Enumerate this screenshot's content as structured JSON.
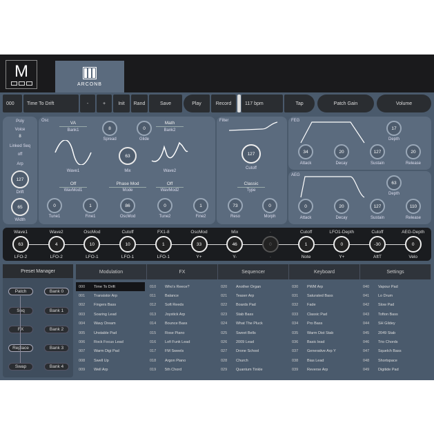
{
  "brand": {
    "logo": "M",
    "tab": "ARCONB"
  },
  "transport": {
    "patch_no": "000",
    "patch_name": "Time To Drift",
    "minus": "-",
    "plus": "+",
    "init": "Init",
    "rand": "Rand",
    "save": "Save",
    "play": "Play",
    "record": "Record",
    "bpm": "117 bpm",
    "tap": "Tap",
    "patch_gain": "Patch Gain",
    "volume": "Volume"
  },
  "voice": {
    "poly": "Poly",
    "voice": "Voice",
    "voice_val": "8",
    "linked": "Linked Seq",
    "off": "off",
    "arp": "Arp",
    "drift": "127",
    "drift_lbl": "Drift",
    "width": "65",
    "width_lbl": "Width"
  },
  "osc": {
    "title": "Osc",
    "wave1_type": "VA",
    "wave1_bank": "Bank1",
    "spread": "8",
    "spread_lbl": "Spread",
    "glide": "0",
    "glide_lbl": "Glide",
    "wave2_type": "Math",
    "wave2_bank": "Bank2",
    "wave1_lbl": "Wave1",
    "mix": "63",
    "mix_lbl": "Mix",
    "wave2_lbl": "Wave2",
    "wm1": "Off",
    "wm1_lbl": "WavMod1",
    "mode": "Phase Mod",
    "mode_lbl": "Mode",
    "wm2": "Off",
    "wm2_lbl": "WavMod2",
    "tune1": "0",
    "tune1_lbl": "Tune1",
    "fine1": "1",
    "fine1_lbl": "Fine1",
    "oscmod": "86",
    "oscmod_lbl": "OscMod",
    "tune2": "0",
    "tune2_lbl": "Tune2",
    "fine2": "1",
    "fine2_lbl": "Fine2"
  },
  "filter": {
    "title": "Filter",
    "cutoff": "127",
    "cutoff_lbl": "Cutoff",
    "type": "Classic",
    "type_lbl": "Type",
    "reso": "73",
    "reso_lbl": "Reso",
    "morph": "0",
    "morph_lbl": "Morph"
  },
  "feg": {
    "title": "FEG",
    "depth": "17",
    "depth_lbl": "Depth",
    "attack": "34",
    "decay": "20",
    "sustain": "127",
    "release": "20"
  },
  "aeg": {
    "title": "AEG",
    "depth": "63",
    "depth_lbl": "Depth",
    "attack": "0",
    "decay": "20",
    "sustain": "127",
    "release": "110"
  },
  "env_lbls": {
    "attack": "Attack",
    "decay": "Decay",
    "sustain": "Sustain",
    "release": "Release"
  },
  "mods": [
    {
      "t": "Wave1",
      "v": "63",
      "b": "LFO-2"
    },
    {
      "t": "Wave2",
      "v": "4",
      "b": "LFO-2"
    },
    {
      "t": "OscMod",
      "v": "10",
      "b": "LFO-1"
    },
    {
      "t": "Cutoff",
      "v": "10",
      "b": "LFO-1"
    },
    {
      "t": "FX1-8",
      "v": "1",
      "b": "LFO-1"
    },
    {
      "t": "OscMod",
      "v": "33",
      "b": "Y+"
    },
    {
      "t": "Mix",
      "v": "46",
      "b": "Y-"
    },
    {
      "t": "-",
      "v": "0",
      "b": "-"
    },
    {
      "t": "Cutoff",
      "v": "1",
      "b": "Note"
    },
    {
      "t": "LFO1-Depth",
      "v": "0",
      "b": "Y+"
    },
    {
      "t": "Cutoff",
      "v": "-30",
      "b": "AftT"
    },
    {
      "t": "AEG-Depth",
      "v": "0",
      "b": "Velo"
    }
  ],
  "preset_manager": {
    "title": "Preset Manager",
    "patch": "Patch",
    "seq": "Seq",
    "fx": "FX",
    "replace": "Replace",
    "swap": "Swap",
    "bank0": "Bank 0",
    "bank1": "Bank 1",
    "bank2": "Bank 2",
    "bank3": "Bank 3",
    "bank4": "Bank 4"
  },
  "columns": [
    {
      "head": "Modulation",
      "rows": [
        [
          "000",
          "Time To Drift"
        ],
        [
          "001",
          "Transistor Arp"
        ],
        [
          "002",
          "Fingers Bass"
        ],
        [
          "003",
          "Soaring Lead"
        ],
        [
          "004",
          "Wavy Dream"
        ],
        [
          "005",
          "Unstable Pad"
        ],
        [
          "006",
          "Rock Focus Lead"
        ],
        [
          "007",
          "Warm Digi Pad"
        ],
        [
          "008",
          "Swell Up"
        ],
        [
          "009",
          "Well Arp"
        ]
      ]
    },
    {
      "head": "FX",
      "rows": [
        [
          "010",
          "Who's Reece?"
        ],
        [
          "011",
          "Balance"
        ],
        [
          "012",
          "Soft Reeds"
        ],
        [
          "013",
          "Joystick Arp"
        ],
        [
          "014",
          "Bounce Bass"
        ],
        [
          "015",
          "Rose Piano"
        ],
        [
          "016",
          "Lofi Funk Lead"
        ],
        [
          "017",
          "FM Sweels"
        ],
        [
          "018",
          "Argon Piano"
        ],
        [
          "019",
          "5th Chord"
        ]
      ]
    },
    {
      "head": "Sequencer",
      "rows": [
        [
          "020",
          "Another Organ"
        ],
        [
          "021",
          "Teaser Arp"
        ],
        [
          "022",
          "Boards Pad"
        ],
        [
          "023",
          "Stab Bass"
        ],
        [
          "024",
          "What The Pluck"
        ],
        [
          "025",
          "Sweet Bells"
        ],
        [
          "026",
          "2009 Lead"
        ],
        [
          "027",
          "Drone School"
        ],
        [
          "028",
          "Church"
        ],
        [
          "029",
          "Quantum Tinkle"
        ]
      ]
    },
    {
      "head": "Keyboard",
      "rows": [
        [
          "030",
          "PWM Arp"
        ],
        [
          "031",
          "Saturated Bass"
        ],
        [
          "032",
          "Fade"
        ],
        [
          "033",
          "Classic Pad"
        ],
        [
          "034",
          "Pro Bass"
        ],
        [
          "035",
          "Warm Dist Stab"
        ],
        [
          "036",
          "Basic lead"
        ],
        [
          "037",
          "Generative Arp Y"
        ],
        [
          "038",
          "Bias Lead"
        ],
        [
          "039",
          "Reverse Arp"
        ]
      ]
    },
    {
      "head": "Settings",
      "rows": [
        [
          "040",
          "Vapour Pad"
        ],
        [
          "041",
          "Lo Drum"
        ],
        [
          "042",
          "Slow Pad"
        ],
        [
          "043",
          "Tofton Bass"
        ],
        [
          "044",
          "SH Gildey"
        ],
        [
          "045",
          "2049 Stab"
        ],
        [
          "046",
          "Trio Chords"
        ],
        [
          "047",
          "Squelch Bass"
        ],
        [
          "048",
          "Shortspace"
        ],
        [
          "049",
          "Digitide Pad"
        ]
      ]
    }
  ]
}
